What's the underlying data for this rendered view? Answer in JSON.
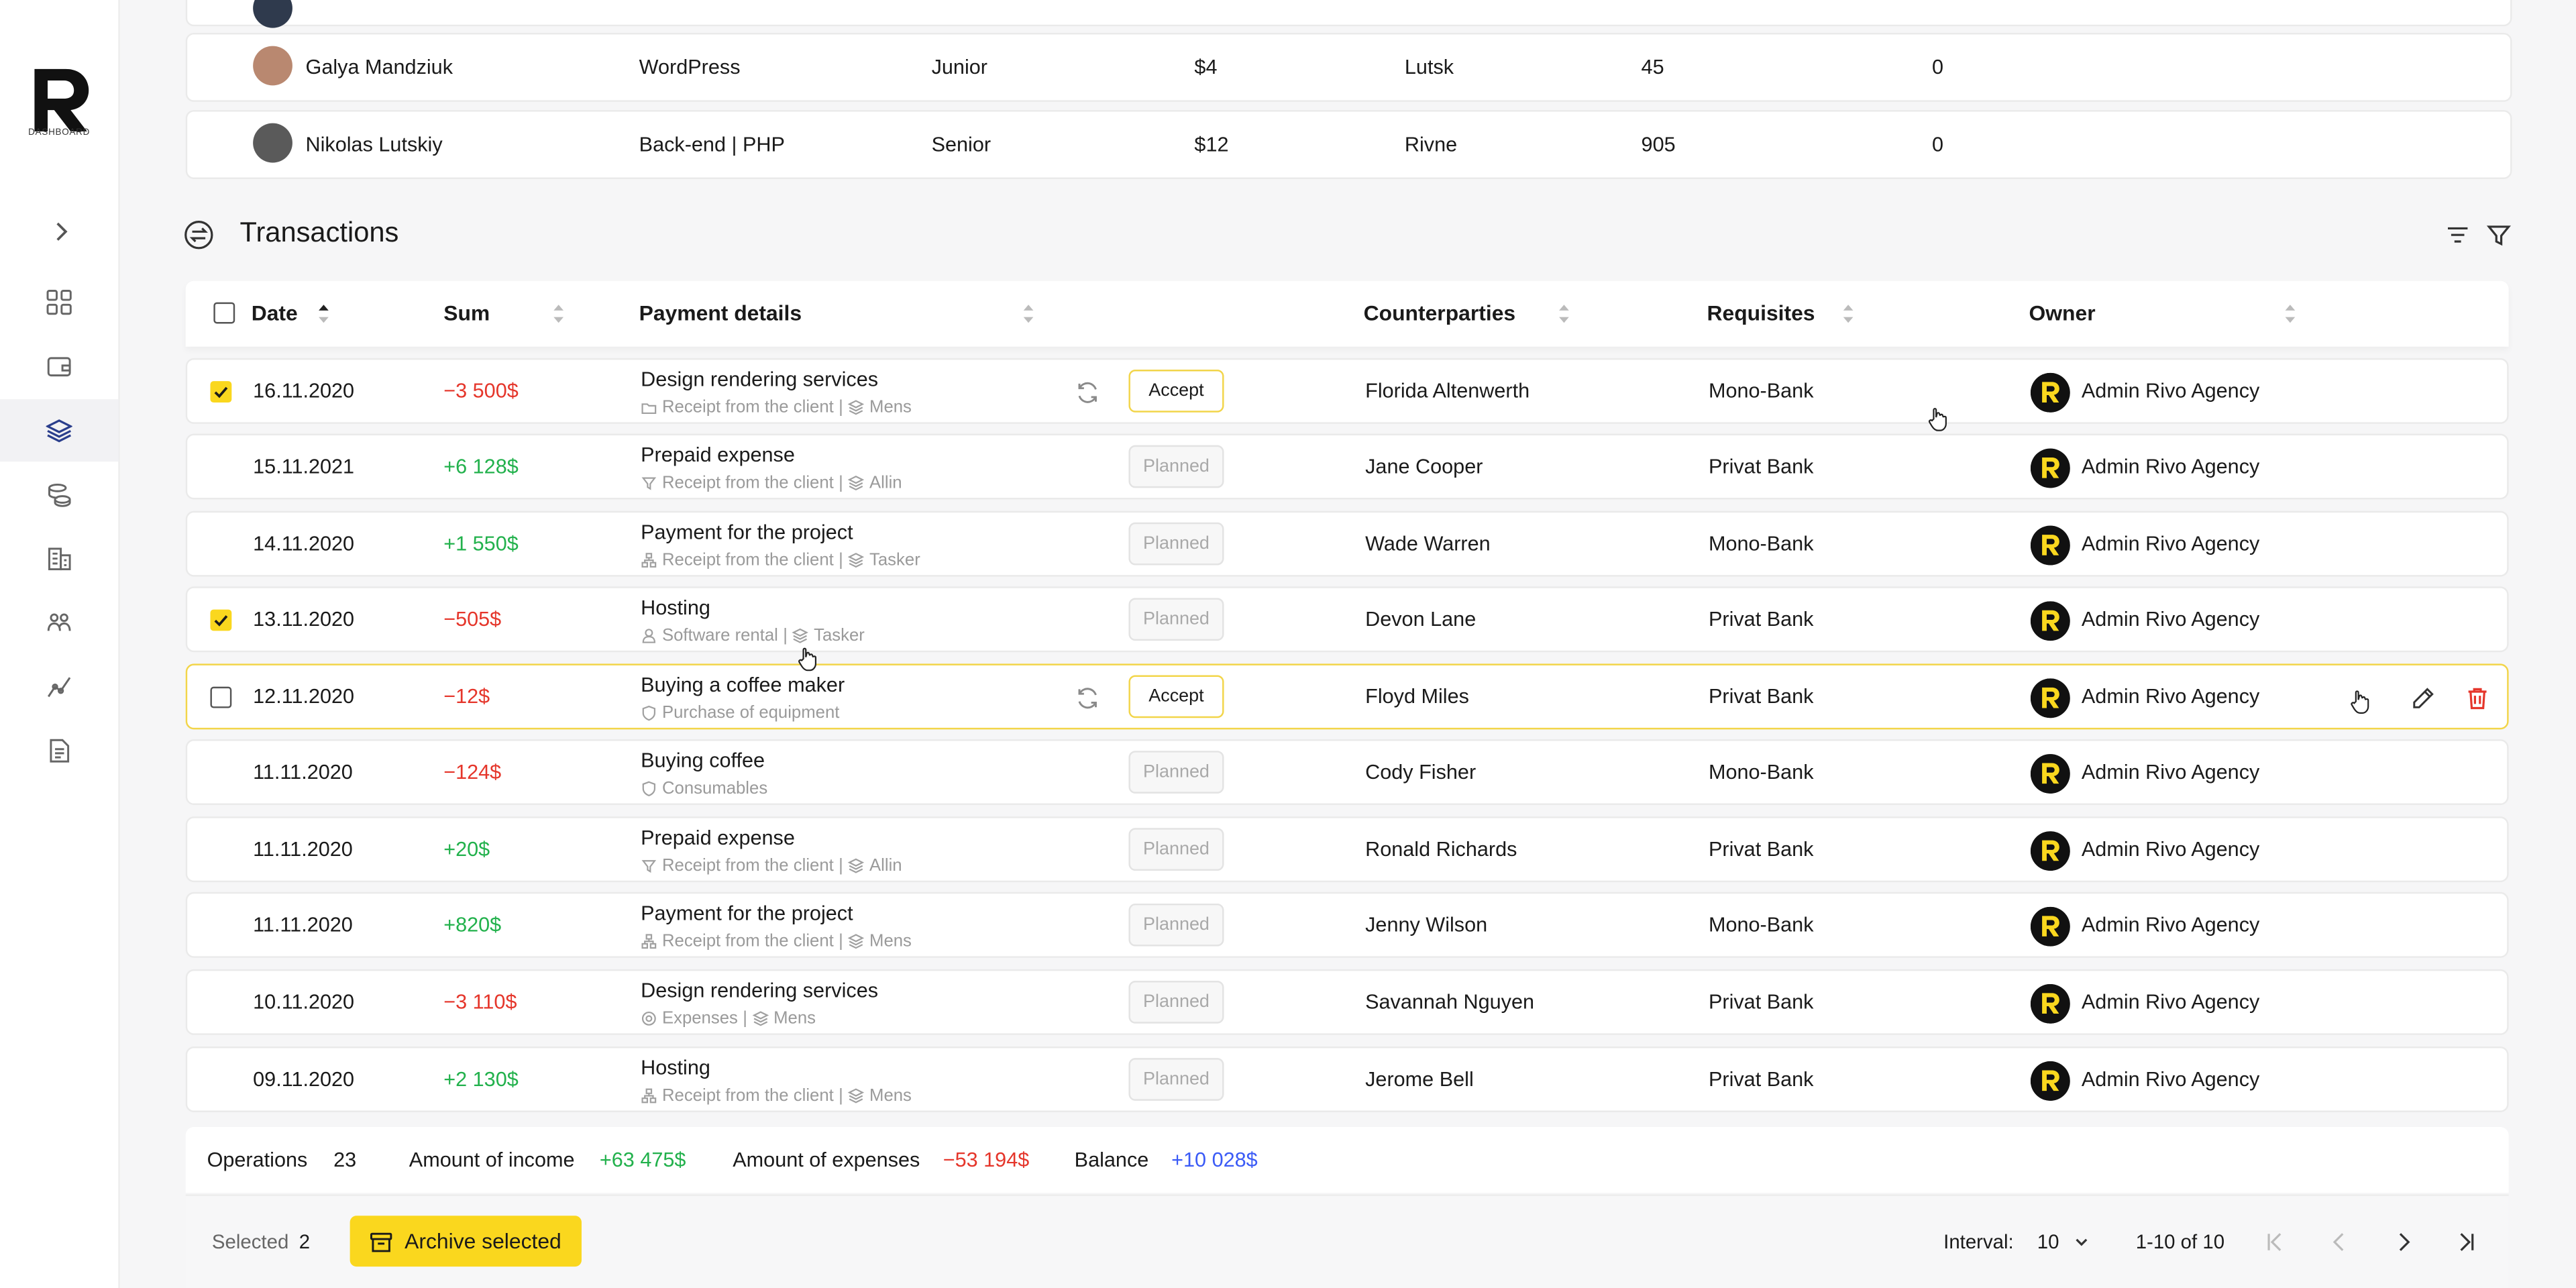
{
  "sidebar": {
    "logo_text": "DASHBOARD",
    "items": [
      {
        "icon": "grid-icon"
      },
      {
        "icon": "wallet-icon"
      },
      {
        "icon": "layers-icon",
        "active": true
      },
      {
        "icon": "coins-icon"
      },
      {
        "icon": "building-icon"
      },
      {
        "icon": "team-icon"
      },
      {
        "icon": "analytics-icon"
      },
      {
        "icon": "document-icon"
      }
    ]
  },
  "people_rows": [
    {
      "name": "Galya Mandziuk",
      "direction": "WordPress",
      "level": "Junior",
      "rate": "$4",
      "city": "Lutsk",
      "hours": "45",
      "extra": "0"
    },
    {
      "name": "Nikolas Lutskiy",
      "direction": "Back-end | PHP",
      "level": "Senior",
      "rate": "$12",
      "city": "Rivne",
      "hours": "905",
      "extra": "0"
    }
  ],
  "transactions": {
    "title": "Transactions",
    "columns": {
      "date": "Date",
      "sum": "Sum",
      "payment_details": "Payment details",
      "counterparties": "Counterparties",
      "requisites": "Requisites",
      "owner": "Owner"
    },
    "rows": [
      {
        "checked": true,
        "date": "16.11.2020",
        "sum": "−3 500$",
        "sum_type": "neg",
        "title": "Design rendering services",
        "sub_a": "Receipt from the client",
        "sub_b": "Mens",
        "sub_icon": "folder-icon",
        "status": "Accept",
        "counterparty": "Florida Altenwerth",
        "requisite": "Mono-Bank",
        "owner": "Admin Rivo Agency"
      },
      {
        "checked": false,
        "date": "15.11.2021",
        "sum": "+6 128$",
        "sum_type": "pos",
        "title": "Prepaid expense",
        "sub_a": "Receipt from the client",
        "sub_b": "Allin",
        "sub_icon": "funnel-icon",
        "status": "Planned",
        "counterparty": "Jane Cooper",
        "requisite": "Privat Bank",
        "owner": "Admin Rivo Agency"
      },
      {
        "checked": false,
        "date": "14.11.2020",
        "sum": "+1 550$",
        "sum_type": "pos",
        "title": "Payment for the project",
        "sub_a": "Receipt from the client",
        "sub_b": "Tasker",
        "sub_icon": "sitemap-icon",
        "status": "Planned",
        "counterparty": "Wade Warren",
        "requisite": "Mono-Bank",
        "owner": "Admin Rivo Agency"
      },
      {
        "checked": true,
        "date": "13.11.2020",
        "sum": "−505$",
        "sum_type": "neg",
        "title": "Hosting",
        "sub_a": "Software rental",
        "sub_b": "Tasker",
        "sub_icon": "user-icon",
        "status": "Planned",
        "counterparty": "Devon Lane",
        "requisite": "Privat Bank",
        "owner": "Admin Rivo Agency"
      },
      {
        "checked": false,
        "date": "12.11.2020",
        "sum": "−12$",
        "sum_type": "neg",
        "title": "Buying a coffee maker",
        "sub_a": "Purchase of equipment",
        "sub_b": "",
        "sub_icon": "shield-icon",
        "status": "Accept",
        "counterparty": "Floyd Miles",
        "requisite": "Privat Bank",
        "owner": "Admin Rivo Agency",
        "highlight": true
      },
      {
        "checked": false,
        "date": "11.11.2020",
        "sum": "−124$",
        "sum_type": "neg",
        "title": "Buying coffee",
        "sub_a": "Consumables",
        "sub_b": "",
        "sub_icon": "shield-icon",
        "status": "Planned",
        "counterparty": "Cody Fisher",
        "requisite": "Mono-Bank",
        "owner": "Admin Rivo Agency"
      },
      {
        "checked": false,
        "date": "11.11.2020",
        "sum": "+20$",
        "sum_type": "pos",
        "title": "Prepaid expense",
        "sub_a": "Receipt from the client",
        "sub_b": "Allin",
        "sub_icon": "funnel-icon",
        "status": "Planned",
        "counterparty": "Ronald Richards",
        "requisite": "Privat Bank",
        "owner": "Admin Rivo Agency"
      },
      {
        "checked": false,
        "date": "11.11.2020",
        "sum": "+820$",
        "sum_type": "pos",
        "title": "Payment for the project",
        "sub_a": "Receipt from the client",
        "sub_b": "Mens",
        "sub_icon": "sitemap-icon",
        "status": "Planned",
        "counterparty": "Jenny Wilson",
        "requisite": "Mono-Bank",
        "owner": "Admin Rivo Agency"
      },
      {
        "checked": false,
        "date": "10.11.2020",
        "sum": "−3 110$",
        "sum_type": "neg",
        "title": "Design rendering services",
        "sub_a": "Expenses",
        "sub_b": "Mens",
        "sub_icon": "target-icon",
        "status": "Planned",
        "counterparty": "Savannah Nguyen",
        "requisite": "Privat Bank",
        "owner": "Admin Rivo Agency"
      },
      {
        "checked": false,
        "date": "09.11.2020",
        "sum": "+2 130$",
        "sum_type": "pos",
        "title": "Hosting",
        "sub_a": "Receipt from the client",
        "sub_b": "Mens",
        "sub_icon": "sitemap-icon",
        "status": "Planned",
        "counterparty": "Jerome Bell",
        "requisite": "Privat Bank",
        "owner": "Admin Rivo Agency"
      }
    ]
  },
  "summary": {
    "operations_label": "Operations",
    "operations_value": "23",
    "income_label": "Amount of income",
    "income_value": "+63 475$",
    "expenses_label": "Amount of expenses",
    "expenses_value": "−53 194$",
    "balance_label": "Balance",
    "balance_value": "+10 028$"
  },
  "footer": {
    "selected_label": "Selected",
    "selected_count": "2",
    "archive_label": "Archive selected",
    "interval_label": "Interval:",
    "interval_value": "10",
    "range_text": "1-10 of 10"
  },
  "colors": {
    "accent": "#FAD71E",
    "negative": "#E5362B",
    "positive": "#22B14C",
    "balance": "#3B5BF6"
  }
}
